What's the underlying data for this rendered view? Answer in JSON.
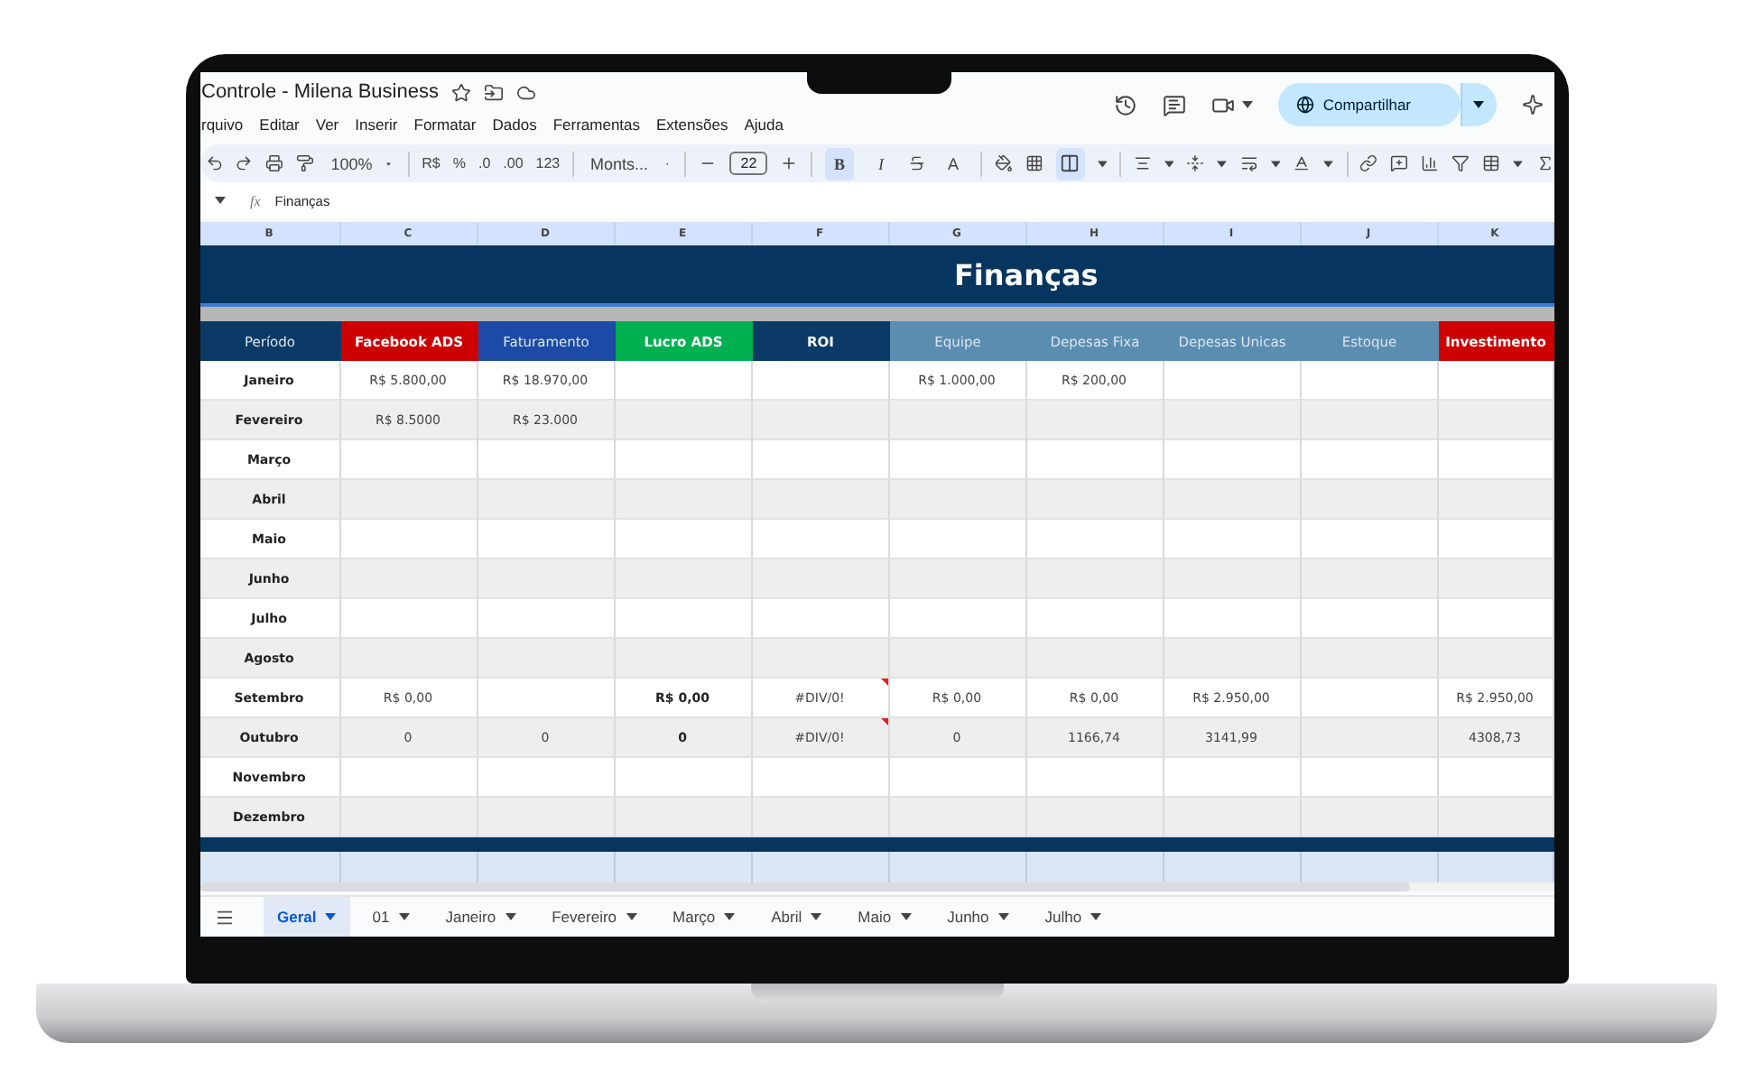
{
  "header": {
    "title": "Controle - Milena Business",
    "menus": [
      "rquivo",
      "Editar",
      "Ver",
      "Inserir",
      "Formatar",
      "Dados",
      "Ferramentas",
      "Extensões",
      "Ajuda"
    ],
    "share_button": "Compartilhar"
  },
  "toolbar": {
    "zoom": "100%",
    "currency": "R$",
    "percent": "%",
    "decimal_less": ".0",
    "decimal_more": ".00",
    "number_format": "123",
    "font": "Monts...",
    "font_size": "22",
    "bold": {
      "label": "B",
      "selected": true
    },
    "italic": {
      "label": "I",
      "selected": false
    },
    "text_color": {
      "label": "A"
    },
    "merge": {
      "selected": true
    }
  },
  "formula_bar": {
    "fx": "fx",
    "value": "Finanças"
  },
  "sheet": {
    "title": "Finanças",
    "columns": [
      {
        "letter": "B",
        "heading": "Período",
        "color": "#0b3a66",
        "bold": false,
        "values_bold": true
      },
      {
        "letter": "C",
        "heading": "Facebook ADS",
        "color": "#cc0000",
        "bold": true,
        "values_bold": false
      },
      {
        "letter": "D",
        "heading": "Faturamento",
        "color": "#1c4aa6",
        "bold": false,
        "values_bold": false
      },
      {
        "letter": "E",
        "heading": "Lucro ADS",
        "color": "#00b050",
        "bold": true,
        "values_bold": true
      },
      {
        "letter": "F",
        "heading": "ROI",
        "color": "#0b3a66",
        "bold": true,
        "values_bold": false
      },
      {
        "letter": "G",
        "heading": "Equipe",
        "color": "#5a8db0",
        "bold": false,
        "values_bold": false
      },
      {
        "letter": "H",
        "heading": "Depesas Fixa",
        "color": "#5a8db0",
        "bold": false,
        "values_bold": false
      },
      {
        "letter": "I",
        "heading": "Depesas Unicas",
        "color": "#5a8db0",
        "bold": false,
        "values_bold": false
      },
      {
        "letter": "J",
        "heading": "Estoque",
        "color": "#5a8db0",
        "bold": false
      },
      {
        "letter": "K",
        "heading": "Investimento",
        "color": "#cc0000",
        "bold": true,
        "values_bold": false
      }
    ],
    "rows": [
      {
        "cells": [
          "Janeiro",
          "R$ 5.800,00",
          "R$ 18.970,00",
          "",
          "",
          "R$ 1.000,00",
          "R$ 200,00",
          "",
          "",
          ""
        ],
        "roi_flag": false
      },
      {
        "cells": [
          "Fevereiro",
          "R$ 8.5000",
          "R$ 23.000",
          "",
          "",
          "",
          "",
          "",
          "",
          ""
        ],
        "roi_flag": false
      },
      {
        "cells": [
          "Março",
          "",
          "",
          "",
          "",
          "",
          "",
          "",
          "",
          ""
        ],
        "roi_flag": false
      },
      {
        "cells": [
          "Abril",
          "",
          "",
          "",
          "",
          "",
          "",
          "",
          "",
          ""
        ],
        "roi_flag": false
      },
      {
        "cells": [
          "Maio",
          "",
          "",
          "",
          "",
          "",
          "",
          "",
          "",
          ""
        ],
        "roi_flag": false
      },
      {
        "cells": [
          "Junho",
          "",
          "",
          "",
          "",
          "",
          "",
          "",
          "",
          ""
        ],
        "roi_flag": false
      },
      {
        "cells": [
          "Julho",
          "",
          "",
          "",
          "",
          "",
          "",
          "",
          "",
          ""
        ],
        "roi_flag": false
      },
      {
        "cells": [
          "Agosto",
          "",
          "",
          "",
          "",
          "",
          "",
          "",
          "",
          ""
        ],
        "roi_flag": false
      },
      {
        "cells": [
          "Setembro",
          "R$ 0,00",
          "",
          "R$ 0,00",
          "#DIV/0!",
          "R$ 0,00",
          "R$ 0,00",
          "R$ 2.950,00",
          "",
          "R$ 2.950,00"
        ],
        "roi_flag": true
      },
      {
        "cells": [
          "Outubro",
          "0",
          "0",
          "0",
          "#DIV/0!",
          "0",
          "1166,74",
          "3141,99",
          "",
          "4308,73"
        ],
        "roi_flag": true
      },
      {
        "cells": [
          "Novembro",
          "",
          "",
          "",
          "",
          "",
          "",
          "",
          "",
          ""
        ],
        "roi_flag": false
      },
      {
        "cells": [
          "Dezembro",
          "",
          "",
          "",
          "",
          "",
          "",
          "",
          "",
          ""
        ],
        "roi_flag": false
      }
    ]
  },
  "sheet_tabs": [
    {
      "label": "Geral",
      "selected": true
    },
    {
      "label": "01",
      "selected": false
    },
    {
      "label": "Janeiro",
      "selected": false
    },
    {
      "label": "Fevereiro",
      "selected": false
    },
    {
      "label": "Março",
      "selected": false
    },
    {
      "label": "Abril",
      "selected": false
    },
    {
      "label": "Maio",
      "selected": false
    },
    {
      "label": "Junho",
      "selected": false
    },
    {
      "label": "Julho",
      "selected": false
    }
  ]
}
